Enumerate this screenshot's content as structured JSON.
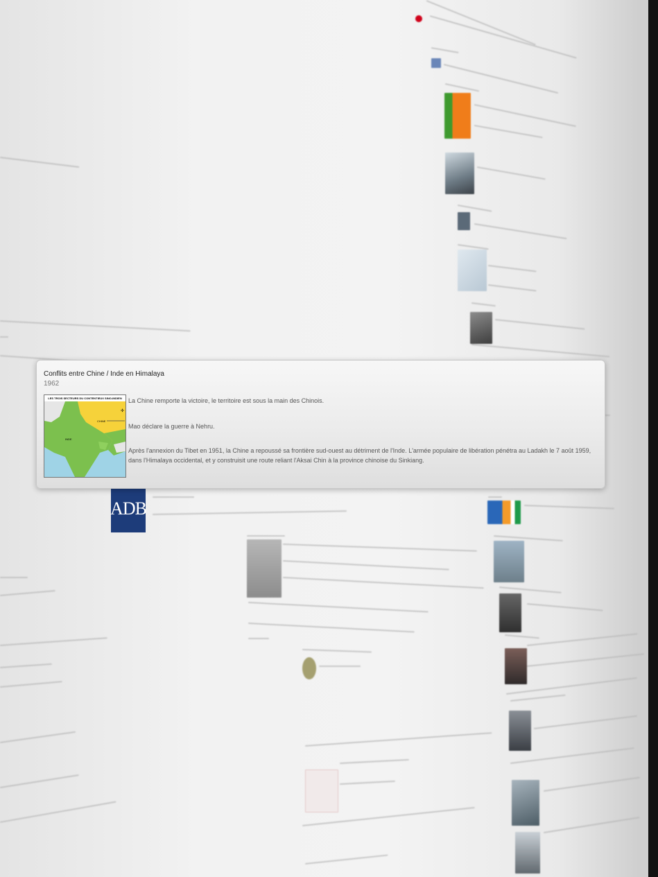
{
  "popup": {
    "title": "Conflits entre Chine / Inde en Himalaya",
    "year": "1962",
    "map_header": "LES TROIS SECTEURS DU CONTENTIEUX SINO-INDIEN",
    "paragraphs": [
      "La Chine remporte la victoire, le territoire est sous la main des Chinois.",
      "Mao déclare la guerre à Nehru.",
      "Après l'annexion du Tibet en 1951, la Chine a repoussé sa frontière sud-ouest au détriment de l'Inde. L'armée populaire de libération pénétra au Ladakh le 7 août 1959, dans l'Himalaya occidental, et y construisit une route reliant l'Aksai Chin à la province chinoise du Sinkiang."
    ]
  },
  "logos": {
    "adb": "ADB"
  },
  "colors": {
    "map_land": "#7cc04e",
    "map_china": "#f6d23a",
    "map_sea": "#9fd3e6",
    "adb_blue": "#1d3c7a",
    "red_dot": "#d0021b"
  }
}
